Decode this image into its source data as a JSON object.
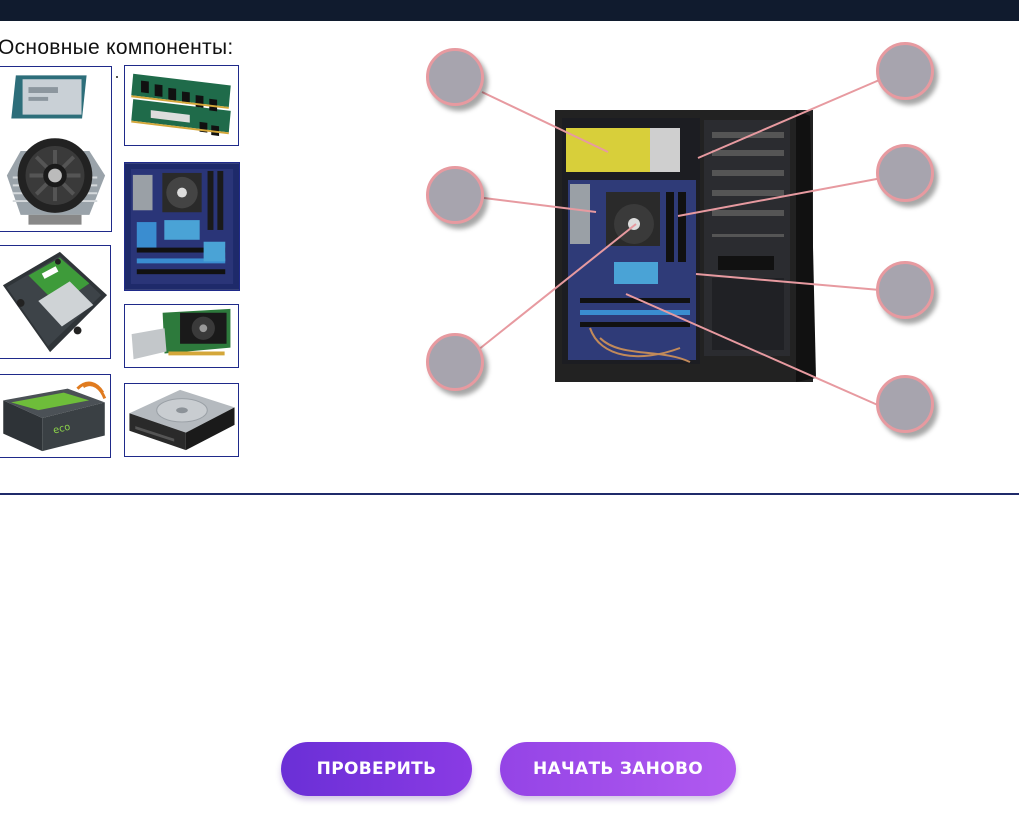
{
  "heading": "Основные компоненты:",
  "components": [
    {
      "name": "cpu-cooler"
    },
    {
      "name": "ram"
    },
    {
      "name": "motherboard"
    },
    {
      "name": "hdd"
    },
    {
      "name": "gpu"
    },
    {
      "name": "psu"
    },
    {
      "name": "optical-drive"
    }
  ],
  "buttons": {
    "check": "ПРОВЕРИТЬ",
    "reset": "НАЧАТЬ ЗАНОВО"
  },
  "colors": {
    "topbar": "#101b2e",
    "tile_border": "#1f2a8a",
    "drop_fill": "#a7a4ae",
    "drop_border": "#e79aa0",
    "button_primary": "#7a35dd",
    "button_secondary": "#a44ee9"
  }
}
